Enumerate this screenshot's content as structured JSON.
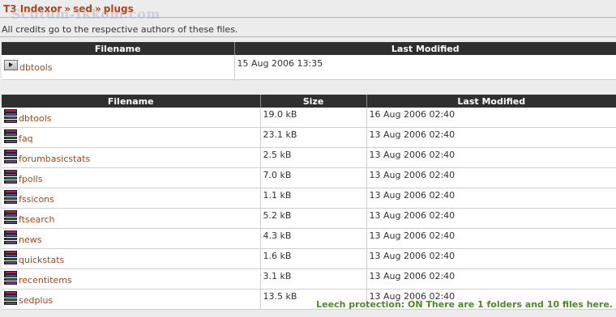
{
  "breadcrumb": {
    "items": [
      "T3 Indexor",
      "sed",
      "plugs"
    ],
    "separator": "»",
    "watermark": "Scutum-Ikkom.com"
  },
  "credit_text": "All credits go to the respective authors of these files.",
  "folders_table": {
    "headers": {
      "filename": "Filename",
      "modified": "Last Modified"
    },
    "rows": [
      {
        "name": "dbtools",
        "modified": "15 Aug 2006 13:35"
      }
    ]
  },
  "files_table": {
    "headers": {
      "filename": "Filename",
      "size": "Size",
      "modified": "Last Modified"
    },
    "rows": [
      {
        "name": "dbtools",
        "size": "19.0 kB",
        "modified": "16 Aug 2006 02:40"
      },
      {
        "name": "faq",
        "size": "23.1 kB",
        "modified": "13 Aug 2006 02:40"
      },
      {
        "name": "forumbasicstats",
        "size": "2.5 kB",
        "modified": "13 Aug 2006 02:40"
      },
      {
        "name": "fpolls",
        "size": "7.0 kB",
        "modified": "13 Aug 2006 02:40"
      },
      {
        "name": "fssicons",
        "size": "1.1 kB",
        "modified": "13 Aug 2006 02:40"
      },
      {
        "name": "ftsearch",
        "size": "5.2 kB",
        "modified": "13 Aug 2006 02:40"
      },
      {
        "name": "news",
        "size": "4.3 kB",
        "modified": "13 Aug 2006 02:40"
      },
      {
        "name": "quickstats",
        "size": "1.6 kB",
        "modified": "13 Aug 2006 02:40"
      },
      {
        "name": "recentitems",
        "size": "3.1 kB",
        "modified": "13 Aug 2006 02:40"
      },
      {
        "name": "sedplus",
        "size": "13.5 kB",
        "modified": "13 Aug 2006 02:40"
      }
    ]
  },
  "footer": "Leech protection: ON There are 1 folders and 10 files here.",
  "colors": {
    "link": "#b0451c",
    "header_bg": "#2f2f2f",
    "footer": "#4b8a2a"
  },
  "icons": {
    "folder": "folder-arrow-icon",
    "file": "rar-archive-icon"
  }
}
